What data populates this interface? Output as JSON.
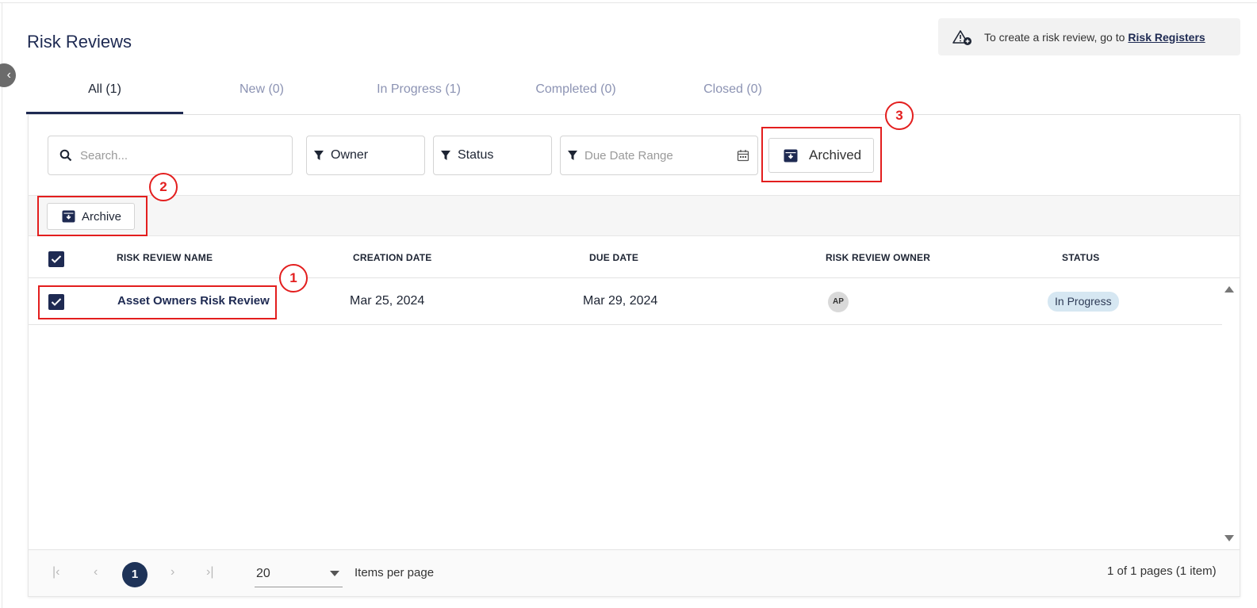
{
  "page": {
    "title": "Risk Reviews"
  },
  "info_banner": {
    "text": "To create a risk review, go to",
    "link_label": "Risk Registers"
  },
  "tabs": [
    {
      "label": "All (1)",
      "active": true
    },
    {
      "label": "New (0)"
    },
    {
      "label": "In Progress (1)"
    },
    {
      "label": "Completed (0)"
    },
    {
      "label": "Closed (0)"
    }
  ],
  "filters": {
    "search_placeholder": "Search...",
    "owner_label": "Owner",
    "status_label": "Status",
    "due_date_placeholder": "Due Date Range",
    "archived_label": "Archived"
  },
  "toolbar": {
    "archive_label": "Archive"
  },
  "table": {
    "columns": [
      "RISK REVIEW NAME",
      "CREATION DATE",
      "DUE DATE",
      "RISK REVIEW OWNER",
      "STATUS"
    ],
    "rows": [
      {
        "name": "Asset Owners Risk Review",
        "creation_date": "Mar 25, 2024",
        "due_date": "Mar 29, 2024",
        "owner_initials": "AP",
        "status": "In Progress",
        "selected": true
      }
    ]
  },
  "pagination": {
    "current_page": "1",
    "page_size": "20",
    "items_per_page_label": "Items per page",
    "summary": "1 of 1 pages (1 item)"
  },
  "annotations": [
    "1",
    "2",
    "3"
  ],
  "colors": {
    "primary": "#1e2a52",
    "annotation": "#e31e1e",
    "badge_bg": "#d6e7f2"
  }
}
